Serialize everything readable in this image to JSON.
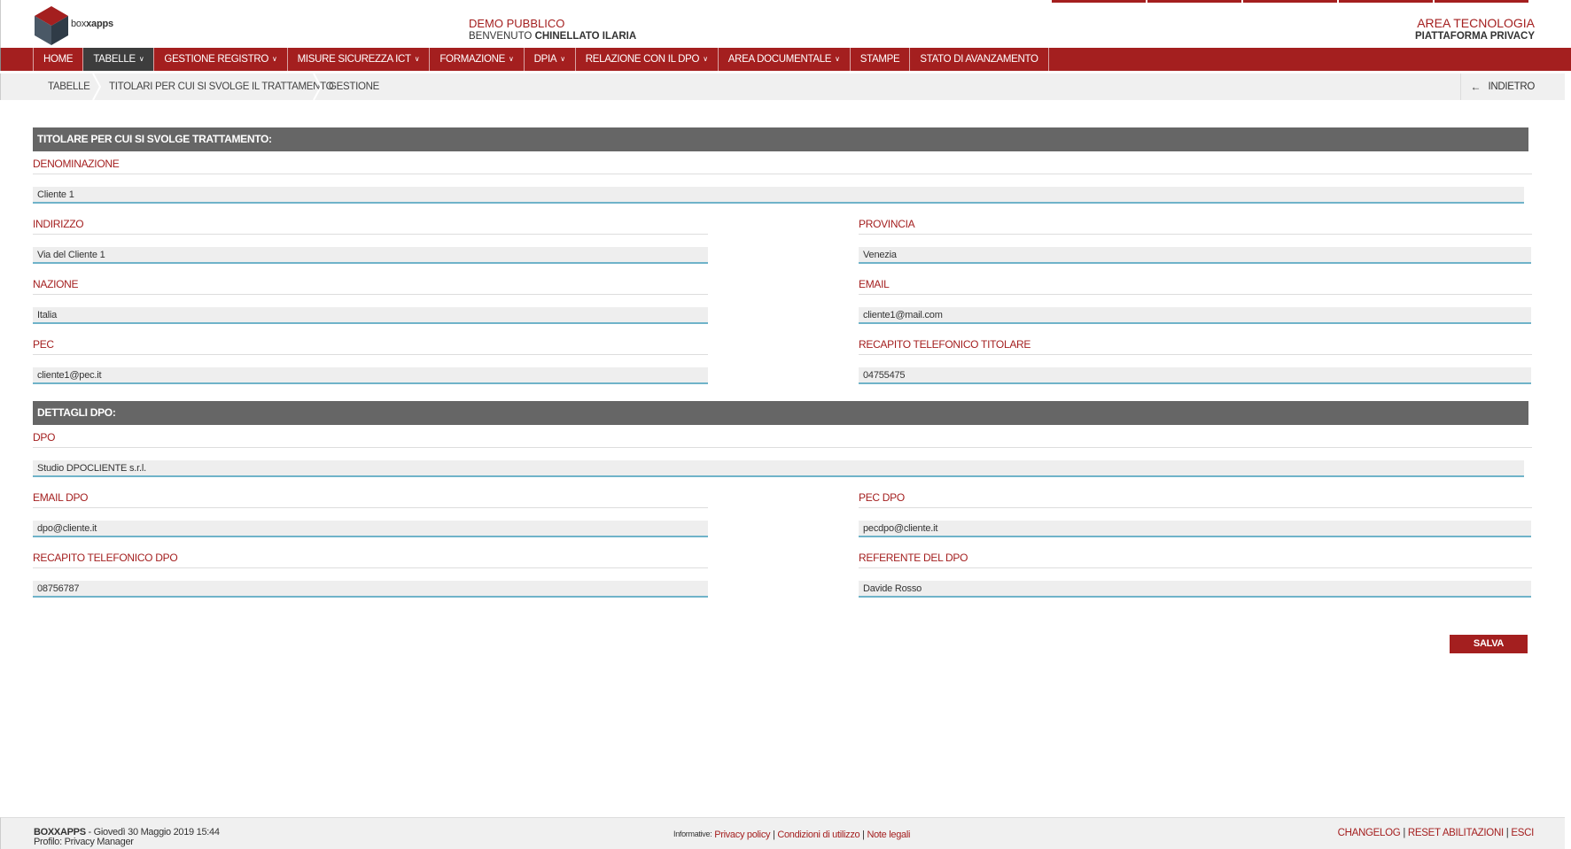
{
  "header": {
    "logo_text_a": "box",
    "logo_text_b": "xapps",
    "demo": "DEMO PUBBLICO",
    "welcome_prefix": "BENVENUTO",
    "user": "CHINELLATO ILARIA",
    "area": "AREA TECNOLOGIA",
    "platform": "PIATTAFORMA PRIVACY"
  },
  "nav": {
    "items": [
      {
        "label": "HOME"
      },
      {
        "label": "TABELLE"
      },
      {
        "label": "GESTIONE REGISTRO"
      },
      {
        "label": "MISURE SICUREZZA ICT"
      },
      {
        "label": "FORMAZIONE"
      },
      {
        "label": "DPIA"
      },
      {
        "label": "RELAZIONE CON IL DPO"
      },
      {
        "label": "AREA DOCUMENTALE"
      },
      {
        "label": "STAMPE"
      },
      {
        "label": "STATO DI AVANZAMENTO"
      }
    ],
    "caret": "∨"
  },
  "breadcrumb": {
    "items": [
      "TABELLE",
      "TITOLARI PER CUI SI SVOLGE IL TRATTAMENTO",
      "GESTIONE"
    ],
    "back_icon": "←",
    "back_label": "INDIETRO"
  },
  "titolare": {
    "section_title": "TITOLARE PER CUI SI SVOLGE TRATTAMENTO:",
    "denominazione": {
      "label": "DENOMINAZIONE",
      "value": "Cliente 1"
    },
    "indirizzo": {
      "label": "INDIRIZZO",
      "value": "Via del Cliente 1"
    },
    "provincia": {
      "label": "PROVINCIA",
      "value": "Venezia"
    },
    "nazione": {
      "label": "NAZIONE",
      "value": "Italia"
    },
    "email": {
      "label": "EMAIL",
      "value": "cliente1@mail.com"
    },
    "pec": {
      "label": "PEC",
      "value": "cliente1@pec.it"
    },
    "recapito": {
      "label": "RECAPITO TELEFONICO TITOLARE",
      "value": "04755475"
    }
  },
  "dpo": {
    "section_title": "DETTAGLI DPO:",
    "dpo": {
      "label": "DPO",
      "value": "Studio DPOCLIENTE s.r.l."
    },
    "email": {
      "label": "EMAIL DPO",
      "value": "dpo@cliente.it"
    },
    "pec": {
      "label": "PEC DPO",
      "value": "pecdpo@cliente.it"
    },
    "recapito": {
      "label": "RECAPITO TELEFONICO DPO",
      "value": "08756787"
    },
    "referente": {
      "label": "REFERENTE DEL DPO",
      "value": "Davide Rosso"
    }
  },
  "actions": {
    "save_label": "SALVA"
  },
  "footer": {
    "brand": "BOXXAPPS",
    "date": " - Giovedì 30 Maggio 2019 15:44",
    "profile": "Profilo: Privacy Manager",
    "informative": "Informative:",
    "privacy": "Privacy policy",
    "conditions": "Condizioni di utilizzo",
    "legal": "Note legali",
    "sep": " | ",
    "changelog": "CHANGELOG",
    "reset": "RESET ABILITAZIONI",
    "exit": "ESCI"
  },
  "colors": {
    "brand": "#a41f1f",
    "section": "#666666",
    "input_underline": "#6fb3c9"
  }
}
